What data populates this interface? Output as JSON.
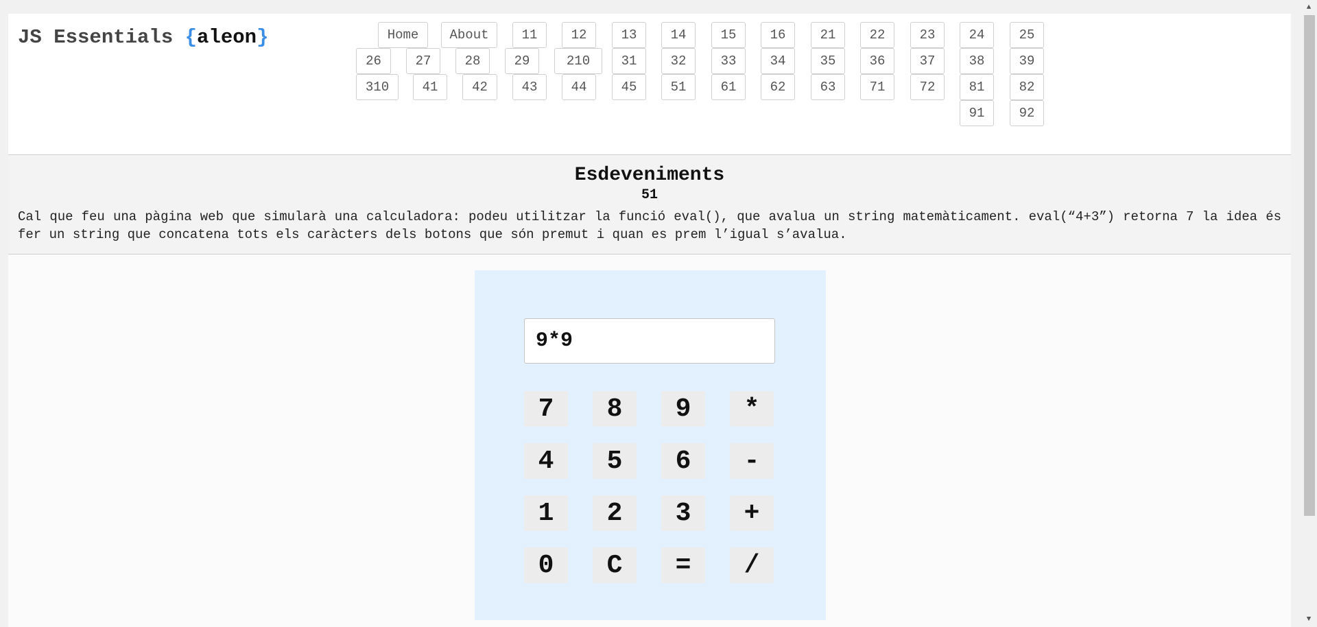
{
  "header": {
    "brand_prefix": "JS Essentials ",
    "brand_open": "{",
    "brand_name": "aleon",
    "brand_close": "}",
    "nav_row1": [
      "Home",
      "About",
      "11",
      "12",
      "13",
      "14",
      "15",
      "16",
      "21",
      "22",
      "23",
      "24",
      "25"
    ],
    "nav_row2": [
      "26",
      "27",
      "28",
      "29",
      "210",
      "31",
      "32",
      "33",
      "34",
      "35",
      "36",
      "37",
      "38",
      "39"
    ],
    "nav_row3": [
      "310",
      "41",
      "42",
      "43",
      "44",
      "45",
      "51",
      "61",
      "62",
      "63",
      "71",
      "72",
      "81",
      "82"
    ],
    "nav_row4": [
      "91",
      "92"
    ]
  },
  "intro": {
    "title": "Esdeveniments",
    "number": "51",
    "description": "Cal que feu una pàgina web que simularà una calculadora: podeu utilitzar la funció eval(), que avalua un string matemàticament. eval(“4+3”) retorna 7 la idea és fer un string que concatena tots els caràcters dels botons que són premut i quan es prem l’igual s’avalua."
  },
  "calculator": {
    "display_value": "9*9",
    "keys": [
      "7",
      "8",
      "9",
      "*",
      "4",
      "5",
      "6",
      "-",
      "1",
      "2",
      "3",
      "+",
      "0",
      "C",
      "=",
      "/"
    ]
  },
  "colors": {
    "brace_accent": "#3a8ee6",
    "calculator_bg": "#e3f0fd"
  }
}
